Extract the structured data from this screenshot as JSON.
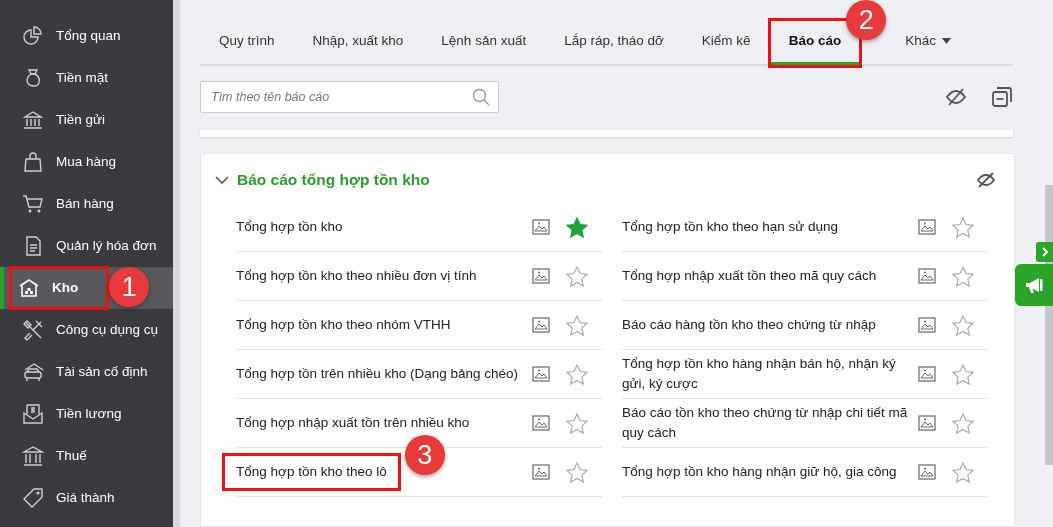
{
  "sidebar": {
    "items": [
      {
        "label": "Tổng quan",
        "selected": false
      },
      {
        "label": "Tiền mặt",
        "selected": false
      },
      {
        "label": "Tiền gửi",
        "selected": false
      },
      {
        "label": "Mua hàng",
        "selected": false
      },
      {
        "label": "Bán hàng",
        "selected": false
      },
      {
        "label": "Quản lý hóa đơn",
        "selected": false
      },
      {
        "label": "Kho",
        "selected": true
      },
      {
        "label": "Công cụ dụng cụ",
        "selected": false
      },
      {
        "label": "Tài sản cố định",
        "selected": false
      },
      {
        "label": "Tiền lương",
        "selected": false
      },
      {
        "label": "Thuế",
        "selected": false
      },
      {
        "label": "Giá thành",
        "selected": false
      }
    ]
  },
  "tabs": [
    {
      "label": "Quy trình",
      "selected": false,
      "kind": "tab"
    },
    {
      "label": "Nhập, xuất kho",
      "selected": false,
      "kind": "tab"
    },
    {
      "label": "Lệnh sản xuất",
      "selected": false,
      "kind": "tab"
    },
    {
      "label": "Lắp ráp, tháo dỡ",
      "selected": false,
      "kind": "tab"
    },
    {
      "label": "Kiểm kê",
      "selected": false,
      "kind": "tab"
    },
    {
      "label": "Báo cáo",
      "selected": true,
      "kind": "tab"
    },
    {
      "label": "Khác",
      "selected": false,
      "kind": "dropdown"
    }
  ],
  "search": {
    "placeholder": "Tìm theo tên báo cáo"
  },
  "section": {
    "title": "Báo cáo tổng hợp tồn kho",
    "expanded": true,
    "columns": [
      [
        {
          "label": "Tổng hợp tồn kho",
          "starred": true
        },
        {
          "label": "Tổng hợp tồn kho theo nhiều đơn vị tính",
          "starred": false
        },
        {
          "label": "Tổng hợp tồn kho theo nhóm VTHH",
          "starred": false
        },
        {
          "label": "Tổng hợp tồn trên nhiều kho (Dạng bảng chéo)",
          "starred": false
        },
        {
          "label": "Tổng hợp nhập xuất tồn trên nhiều kho",
          "starred": false
        },
        {
          "label": "Tổng hợp tồn kho theo lô",
          "starred": false
        }
      ],
      [
        {
          "label": "Tổng hợp tồn kho theo hạn sử dụng",
          "starred": false
        },
        {
          "label": "Tổng hợp nhập xuất tồn theo mã quy cách",
          "starred": false
        },
        {
          "label": "Báo cáo hàng tồn kho theo chứng từ nhập",
          "starred": false
        },
        {
          "label": "Tổng hợp tồn kho hàng nhận bán hộ, nhận ký gửi, ký cược",
          "starred": false
        },
        {
          "label": "Báo cáo tồn kho theo chứng từ nhập chi tiết mã quy cách",
          "starred": false
        },
        {
          "label": "Tổng hợp tồn kho hàng nhận giữ hộ, gia công",
          "starred": false
        }
      ]
    ]
  },
  "callouts": [
    {
      "number": "1"
    },
    {
      "number": "2"
    },
    {
      "number": "3"
    }
  ]
}
